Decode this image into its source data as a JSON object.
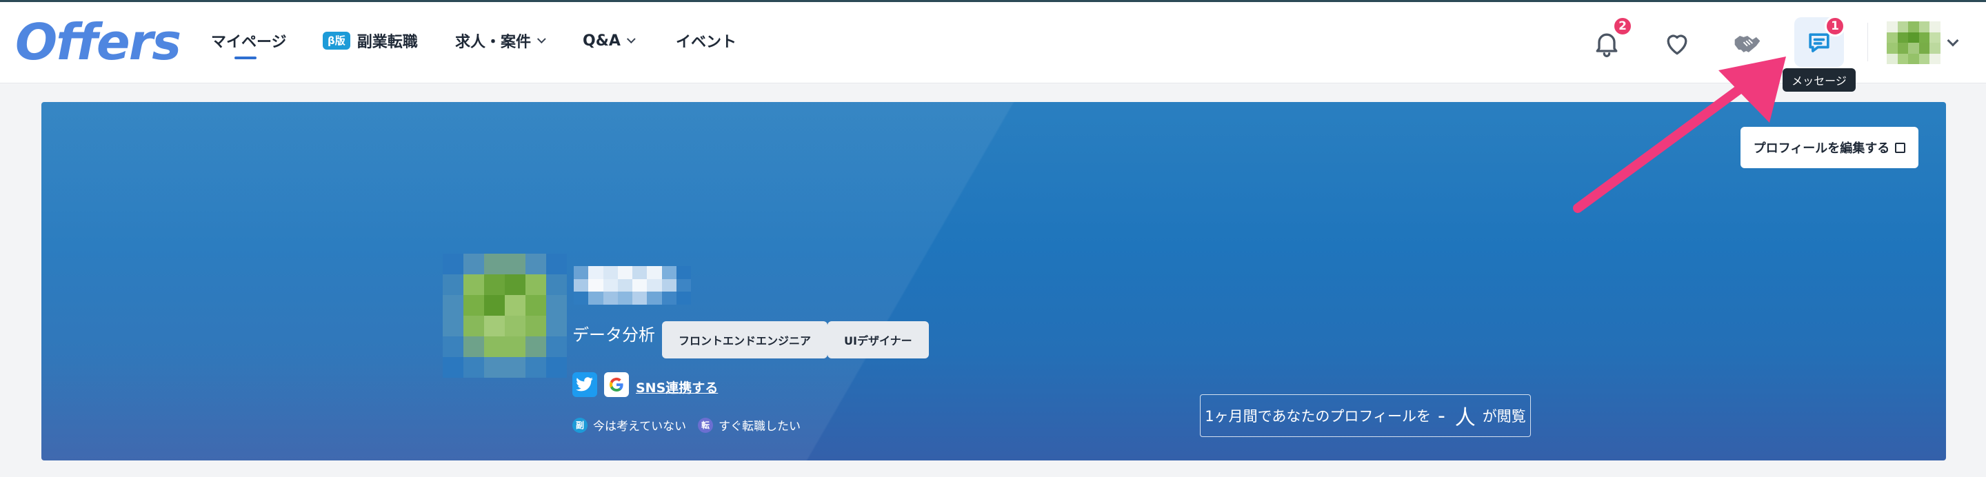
{
  "brand": {
    "logo": "Offers",
    "accent": "#2f6fd1",
    "badge_color": "#ea3a6b"
  },
  "nav": {
    "mypage": "マイページ",
    "beta_badge": "β版",
    "side_job": "副業転職",
    "jobs": "求人・案件",
    "qa": "Q&A",
    "events": "イベント"
  },
  "header_icons": {
    "notifications": {
      "icon": "bell-icon",
      "count": "2"
    },
    "favorites": {
      "icon": "heart-icon"
    },
    "deals": {
      "icon": "handshake-icon"
    },
    "messages": {
      "icon": "chat-icon",
      "count": "1",
      "tooltip": "メッセージ"
    }
  },
  "profile": {
    "edit_button": "プロフィールを編集する",
    "role": "データ分析",
    "tags": [
      "フロントエンドエンジニア",
      "UIデザイナー"
    ],
    "sns_link": "SNS連携する",
    "status": [
      {
        "badge": "副",
        "label": "今は考えていない"
      },
      {
        "badge": "転",
        "label": "すぐ転職したい"
      }
    ],
    "views": {
      "prefix": "1ヶ月間であなたのプロフィールを",
      "count": "-",
      "unit": "人",
      "suffix": "が閲覧"
    }
  }
}
